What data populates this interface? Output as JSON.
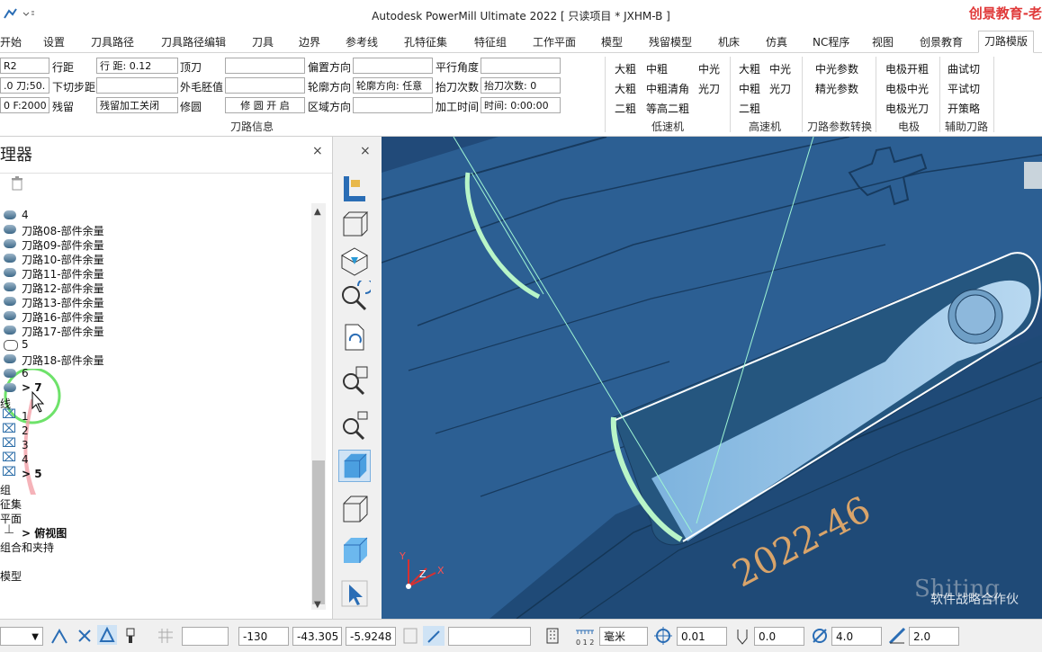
{
  "window": {
    "title": "Autodesk PowerMill Ultimate 2022   [ 只读项目 * JXHM-B ]",
    "brand": "创景教育-老"
  },
  "tabs": [
    "开始",
    "设置",
    "刀具路径",
    "刀具路径编辑",
    "刀具",
    "边界",
    "参考线",
    "孔特征集",
    "特征组",
    "工作平面",
    "模型",
    "残留模型",
    "机床",
    "仿真",
    "NC程序",
    "视图",
    "创景教育",
    "刀路模版"
  ],
  "active_tab": "刀路模版",
  "ribbon": {
    "col1": {
      "v1": "R2",
      "v2": ".0 刀;50.",
      "v3": "0 F:2000"
    },
    "col2": {
      "l1": "行距",
      "l2": "下切步距",
      "l3": "残留"
    },
    "col3": {
      "v1": "行 距: 0.12",
      "v2": "",
      "v3": "残留加工关闭"
    },
    "col4": {
      "l1": "顶刀",
      "l2": "外毛胚值",
      "l3": "修圆"
    },
    "col5": {
      "v1": "",
      "v2": "",
      "v3": "修 圆 开 启"
    },
    "col6": {
      "l1": "偏置方向",
      "l2": "轮廓方向",
      "l3": "区域方向"
    },
    "col7": {
      "v1": "",
      "v2": "轮廓方向: 任意",
      "v3": ""
    },
    "col8": {
      "l1": "平行角度",
      "l2": "抬刀次数",
      "l3": "加工时间"
    },
    "col9": {
      "v1": "",
      "v2": "抬刀次数: 0",
      "v3": "时间: 0:00:00"
    },
    "group_toolpath_info": "刀路信息",
    "low_speed": {
      "items": [
        "大粗",
        "中粗",
        "中光",
        "大粗",
        "中粗清角",
        "光刀",
        "二粗",
        "等高二粗"
      ],
      "label": "低速机"
    },
    "high_speed": {
      "items": [
        "大粗",
        "中光",
        "中粗",
        "光刀",
        "二粗"
      ],
      "label": "高速机"
    },
    "param": {
      "items": [
        "中光参数",
        "精光参数"
      ],
      "label": "刀路参数转换"
    },
    "electrode": {
      "items": [
        "电极开粗",
        "电极中光",
        "电极光刀"
      ],
      "label": "电极"
    },
    "aux": {
      "items": [
        "曲试切",
        "平试切",
        "开策略"
      ],
      "label": "辅助刀路"
    }
  },
  "explorer": {
    "title": "理器",
    "close": "×",
    "items": [
      {
        "label": "4",
        "icon": "tool-icon",
        "indent": 1
      },
      {
        "label": "刀路08-部件余量",
        "icon": "toolpath-icon",
        "indent": 1
      },
      {
        "label": "刀路09-部件余量",
        "icon": "toolpath-icon",
        "indent": 1
      },
      {
        "label": "刀路10-部件余量",
        "icon": "toolpath-icon",
        "indent": 1
      },
      {
        "label": "刀路11-部件余量",
        "icon": "toolpath-icon",
        "indent": 1
      },
      {
        "label": "刀路12-部件余量",
        "icon": "toolpath-icon",
        "indent": 1
      },
      {
        "label": "刀路13-部件余量",
        "icon": "toolpath-icon",
        "indent": 1
      },
      {
        "label": "刀路16-部件余量",
        "icon": "toolpath-icon",
        "indent": 1
      },
      {
        "label": "刀路17-部件余量",
        "icon": "toolpath-icon",
        "indent": 1
      },
      {
        "label": "5",
        "icon": "toolpath-outline-icon",
        "indent": 1
      },
      {
        "label": "刀路18-部件余量",
        "icon": "toolpath-icon",
        "indent": 1
      },
      {
        "label": "6",
        "icon": "tool-icon",
        "indent": 1
      },
      {
        "label": "> 7",
        "icon": "tool-icon",
        "indent": 1,
        "bold": true
      },
      {
        "label": "线",
        "icon": "",
        "indent": 0
      },
      {
        "label": "1",
        "icon": "boundary-icon",
        "indent": 1
      },
      {
        "label": "2",
        "icon": "boundary-icon",
        "indent": 1
      },
      {
        "label": "3",
        "icon": "boundary-icon",
        "indent": 1
      },
      {
        "label": "4",
        "icon": "boundary-icon",
        "indent": 1
      },
      {
        "label": "> 5",
        "icon": "boundary-icon",
        "indent": 1,
        "bold": true
      },
      {
        "label": "组",
        "icon": "",
        "indent": 0
      },
      {
        "label": "征集",
        "icon": "",
        "indent": 0
      },
      {
        "label": "平面",
        "icon": "",
        "indent": 0
      },
      {
        "label": "> 俯视图",
        "icon": "workplane-icon",
        "indent": 1,
        "bold": true
      },
      {
        "label": "组合和夹持",
        "icon": "",
        "indent": 0
      },
      {
        "label": "",
        "icon": "",
        "indent": 0
      },
      {
        "label": "模型",
        "icon": "",
        "indent": 0
      }
    ]
  },
  "vtool_close": "×",
  "viewport": {
    "part_text": "2022-46",
    "watermark": "Shiting",
    "watermark_note": "软件战略合作伙"
  },
  "status": {
    "x": "-130",
    "y": "-43.305",
    "z": "-5.9248",
    "unit": "毫米",
    "tol": "0.01",
    "thickness": "0.0",
    "diameter": "4.0",
    "stepover": "2.0"
  },
  "colors": {
    "viewport_bg": "#214a79",
    "part": "#2c5f93",
    "highlight": "#b8f5c8",
    "accent_blue": "#2a6db5"
  }
}
